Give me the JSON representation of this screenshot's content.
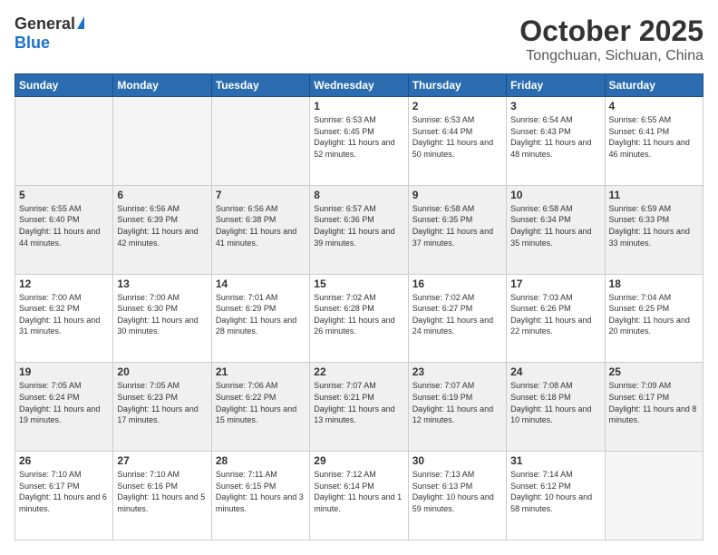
{
  "header": {
    "logo_general": "General",
    "logo_blue": "Blue",
    "title": "October 2025",
    "location": "Tongchuan, Sichuan, China"
  },
  "days_of_week": [
    "Sunday",
    "Monday",
    "Tuesday",
    "Wednesday",
    "Thursday",
    "Friday",
    "Saturday"
  ],
  "weeks": [
    {
      "shaded": false,
      "days": [
        {
          "num": "",
          "info": ""
        },
        {
          "num": "",
          "info": ""
        },
        {
          "num": "",
          "info": ""
        },
        {
          "num": "1",
          "info": "Sunrise: 6:53 AM\nSunset: 6:45 PM\nDaylight: 11 hours\nand 52 minutes."
        },
        {
          "num": "2",
          "info": "Sunrise: 6:53 AM\nSunset: 6:44 PM\nDaylight: 11 hours\nand 50 minutes."
        },
        {
          "num": "3",
          "info": "Sunrise: 6:54 AM\nSunset: 6:43 PM\nDaylight: 11 hours\nand 48 minutes."
        },
        {
          "num": "4",
          "info": "Sunrise: 6:55 AM\nSunset: 6:41 PM\nDaylight: 11 hours\nand 46 minutes."
        }
      ]
    },
    {
      "shaded": true,
      "days": [
        {
          "num": "5",
          "info": "Sunrise: 6:55 AM\nSunset: 6:40 PM\nDaylight: 11 hours\nand 44 minutes."
        },
        {
          "num": "6",
          "info": "Sunrise: 6:56 AM\nSunset: 6:39 PM\nDaylight: 11 hours\nand 42 minutes."
        },
        {
          "num": "7",
          "info": "Sunrise: 6:56 AM\nSunset: 6:38 PM\nDaylight: 11 hours\nand 41 minutes."
        },
        {
          "num": "8",
          "info": "Sunrise: 6:57 AM\nSunset: 6:36 PM\nDaylight: 11 hours\nand 39 minutes."
        },
        {
          "num": "9",
          "info": "Sunrise: 6:58 AM\nSunset: 6:35 PM\nDaylight: 11 hours\nand 37 minutes."
        },
        {
          "num": "10",
          "info": "Sunrise: 6:58 AM\nSunset: 6:34 PM\nDaylight: 11 hours\nand 35 minutes."
        },
        {
          "num": "11",
          "info": "Sunrise: 6:59 AM\nSunset: 6:33 PM\nDaylight: 11 hours\nand 33 minutes."
        }
      ]
    },
    {
      "shaded": false,
      "days": [
        {
          "num": "12",
          "info": "Sunrise: 7:00 AM\nSunset: 6:32 PM\nDaylight: 11 hours\nand 31 minutes."
        },
        {
          "num": "13",
          "info": "Sunrise: 7:00 AM\nSunset: 6:30 PM\nDaylight: 11 hours\nand 30 minutes."
        },
        {
          "num": "14",
          "info": "Sunrise: 7:01 AM\nSunset: 6:29 PM\nDaylight: 11 hours\nand 28 minutes."
        },
        {
          "num": "15",
          "info": "Sunrise: 7:02 AM\nSunset: 6:28 PM\nDaylight: 11 hours\nand 26 minutes."
        },
        {
          "num": "16",
          "info": "Sunrise: 7:02 AM\nSunset: 6:27 PM\nDaylight: 11 hours\nand 24 minutes."
        },
        {
          "num": "17",
          "info": "Sunrise: 7:03 AM\nSunset: 6:26 PM\nDaylight: 11 hours\nand 22 minutes."
        },
        {
          "num": "18",
          "info": "Sunrise: 7:04 AM\nSunset: 6:25 PM\nDaylight: 11 hours\nand 20 minutes."
        }
      ]
    },
    {
      "shaded": true,
      "days": [
        {
          "num": "19",
          "info": "Sunrise: 7:05 AM\nSunset: 6:24 PM\nDaylight: 11 hours\nand 19 minutes."
        },
        {
          "num": "20",
          "info": "Sunrise: 7:05 AM\nSunset: 6:23 PM\nDaylight: 11 hours\nand 17 minutes."
        },
        {
          "num": "21",
          "info": "Sunrise: 7:06 AM\nSunset: 6:22 PM\nDaylight: 11 hours\nand 15 minutes."
        },
        {
          "num": "22",
          "info": "Sunrise: 7:07 AM\nSunset: 6:21 PM\nDaylight: 11 hours\nand 13 minutes."
        },
        {
          "num": "23",
          "info": "Sunrise: 7:07 AM\nSunset: 6:19 PM\nDaylight: 11 hours\nand 12 minutes."
        },
        {
          "num": "24",
          "info": "Sunrise: 7:08 AM\nSunset: 6:18 PM\nDaylight: 11 hours\nand 10 minutes."
        },
        {
          "num": "25",
          "info": "Sunrise: 7:09 AM\nSunset: 6:17 PM\nDaylight: 11 hours\nand 8 minutes."
        }
      ]
    },
    {
      "shaded": false,
      "days": [
        {
          "num": "26",
          "info": "Sunrise: 7:10 AM\nSunset: 6:17 PM\nDaylight: 11 hours\nand 6 minutes."
        },
        {
          "num": "27",
          "info": "Sunrise: 7:10 AM\nSunset: 6:16 PM\nDaylight: 11 hours\nand 5 minutes."
        },
        {
          "num": "28",
          "info": "Sunrise: 7:11 AM\nSunset: 6:15 PM\nDaylight: 11 hours\nand 3 minutes."
        },
        {
          "num": "29",
          "info": "Sunrise: 7:12 AM\nSunset: 6:14 PM\nDaylight: 11 hours\nand 1 minute."
        },
        {
          "num": "30",
          "info": "Sunrise: 7:13 AM\nSunset: 6:13 PM\nDaylight: 10 hours\nand 59 minutes."
        },
        {
          "num": "31",
          "info": "Sunrise: 7:14 AM\nSunset: 6:12 PM\nDaylight: 10 hours\nand 58 minutes."
        },
        {
          "num": "",
          "info": ""
        }
      ]
    }
  ]
}
